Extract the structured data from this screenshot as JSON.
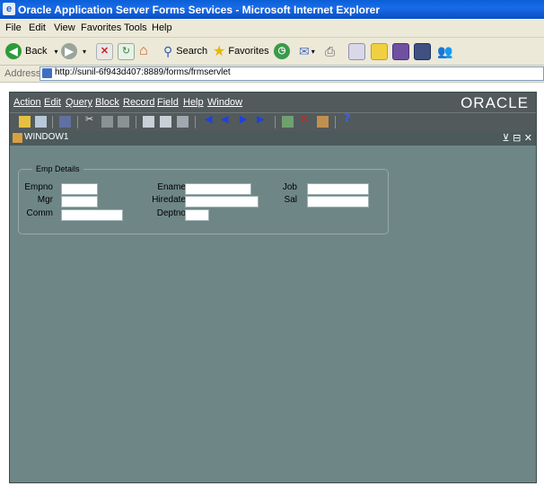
{
  "browser": {
    "title": "Oracle Application Server Forms Services - Microsoft Internet Explorer",
    "menu": [
      "File",
      "Edit",
      "View",
      "Favorites",
      "Tools",
      "Help"
    ],
    "toolbar": {
      "back_label": "Back",
      "search_label": "Search",
      "favorites_label": "Favorites"
    },
    "address_label": "Address",
    "url": "http://sunil-6f943d407:8889/forms/frmservlet"
  },
  "forms": {
    "menu": [
      "Action",
      "Edit",
      "Query",
      "Block",
      "Record",
      "Field",
      "Help",
      "Window"
    ],
    "logo": "ORACLE",
    "window_title": "WINDOW1",
    "window_controls": "⊻ ⊟ ✕",
    "frame_title": "Emp Details",
    "fields": {
      "empno": {
        "label": "Empno",
        "value": ""
      },
      "ename": {
        "label": "Ename",
        "value": ""
      },
      "job": {
        "label": "Job",
        "value": ""
      },
      "mgr": {
        "label": "Mgr",
        "value": ""
      },
      "hiredate": {
        "label": "Hiredate",
        "value": ""
      },
      "sal": {
        "label": "Sal",
        "value": ""
      },
      "comm": {
        "label": "Comm",
        "value": ""
      },
      "deptno": {
        "label": "Deptno",
        "value": ""
      }
    }
  },
  "colors": {
    "canvas": "#6f8686",
    "menubar": "#525a5c",
    "ie_title": "#0a5fd6"
  }
}
